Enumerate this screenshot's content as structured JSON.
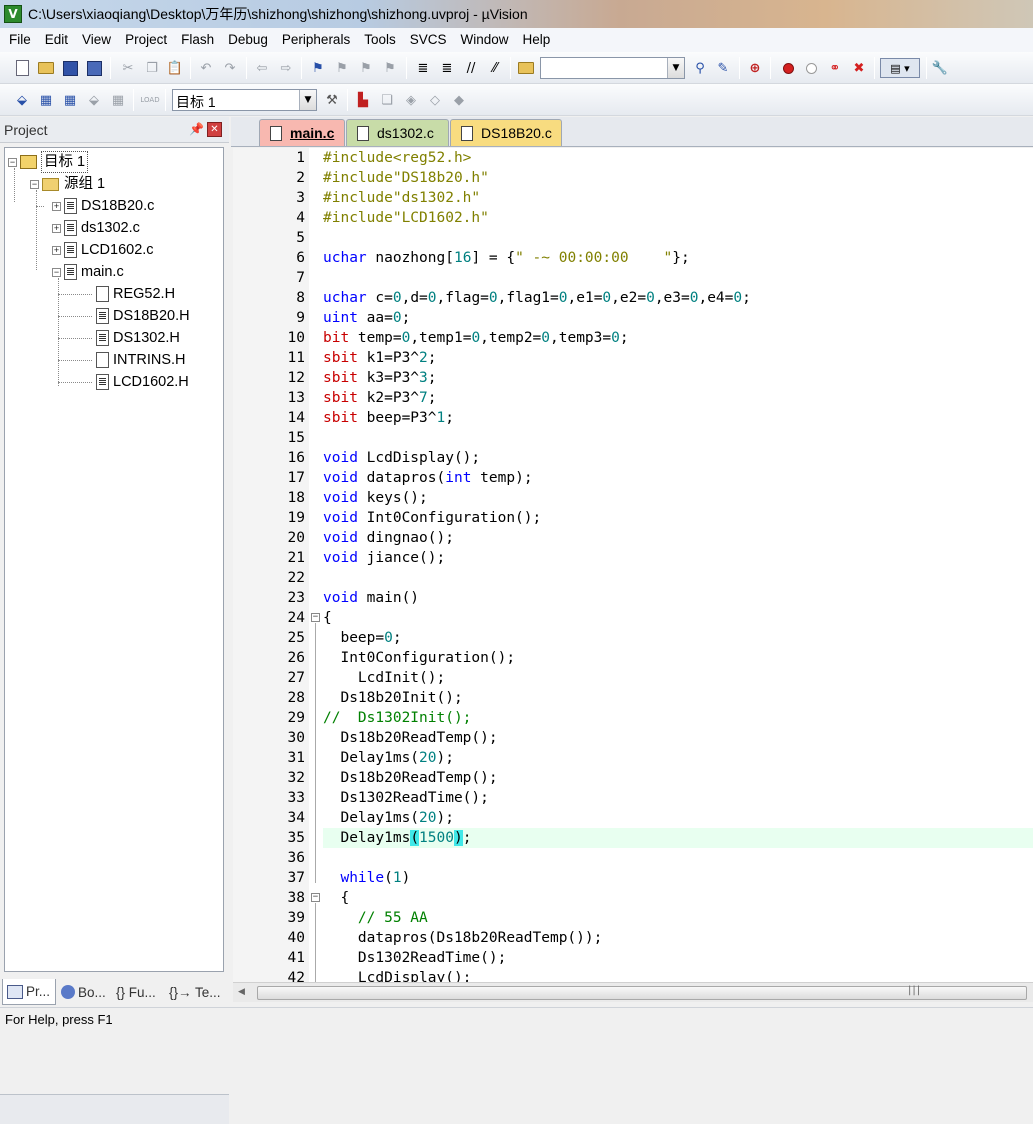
{
  "window": {
    "title": "C:\\Users\\xiaoqiang\\Desktop\\万年历\\shizhong\\shizhong\\shizhong.uvproj - µVision",
    "app_icon_letter": "V"
  },
  "menu": [
    "File",
    "Edit",
    "View",
    "Project",
    "Flash",
    "Debug",
    "Peripherals",
    "Tools",
    "SVCS",
    "Window",
    "Help"
  ],
  "toolbar": {
    "find_combo_value": "",
    "target_combo_value": "目标 1",
    "load_label": "LOAD"
  },
  "project_panel": {
    "title": "Project",
    "tree": {
      "target": "目标 1",
      "group": "源组 1",
      "files": [
        "DS18B20.c",
        "ds1302.c",
        "LCD1602.c",
        "main.c"
      ],
      "main_includes": [
        "REG52.H",
        "DS18B20.H",
        "DS1302.H",
        "INTRINS.H",
        "LCD1602.H"
      ]
    },
    "bottom_tabs": [
      "Pr...",
      "Bo...",
      "{} Fu...",
      "{}→ Te..."
    ]
  },
  "editor": {
    "tabs": [
      "main.c",
      "ds1302.c",
      "DS18B20.c"
    ],
    "active_tab": "main.c",
    "current_line": 35,
    "lines": [
      {
        "n": "1",
        "t": "#include<reg52.h>"
      },
      {
        "n": "2",
        "t": "#include\"DS18b20.h\""
      },
      {
        "n": "3",
        "t": "#include\"ds1302.h\""
      },
      {
        "n": "4",
        "t": "#include\"LCD1602.h\""
      },
      {
        "n": "5",
        "t": ""
      },
      {
        "n": "6",
        "t": "uchar naozhong[16] = {\" -~ 00:00:00    \"};"
      },
      {
        "n": "7",
        "t": ""
      },
      {
        "n": "8",
        "t": "uchar c=0,d=0,flag=0,flag1=0,e1=0,e2=0,e3=0,e4=0;"
      },
      {
        "n": "9",
        "t": "uint aa=0;"
      },
      {
        "n": "10",
        "t": "bit temp=0,temp1=0,temp2=0,temp3=0;"
      },
      {
        "n": "11",
        "t": "sbit k1=P3^2;"
      },
      {
        "n": "12",
        "t": "sbit k3=P3^3;"
      },
      {
        "n": "13",
        "t": "sbit k2=P3^7;"
      },
      {
        "n": "14",
        "t": "sbit beep=P3^1;"
      },
      {
        "n": "15",
        "t": ""
      },
      {
        "n": "16",
        "t": "void LcdDisplay();"
      },
      {
        "n": "17",
        "t": "void datapros(int temp);"
      },
      {
        "n": "18",
        "t": "void keys();"
      },
      {
        "n": "19",
        "t": "void Int0Configuration();"
      },
      {
        "n": "20",
        "t": "void dingnao();"
      },
      {
        "n": "21",
        "t": "void jiance();"
      },
      {
        "n": "22",
        "t": ""
      },
      {
        "n": "23",
        "t": "void main()"
      },
      {
        "n": "24",
        "t": "{"
      },
      {
        "n": "25",
        "t": "  beep=0;"
      },
      {
        "n": "26",
        "t": "  Int0Configuration();"
      },
      {
        "n": "27",
        "t": "    LcdInit();"
      },
      {
        "n": "28",
        "t": "  Ds18b20Init();"
      },
      {
        "n": "29",
        "t": "//  Ds1302Init();"
      },
      {
        "n": "30",
        "t": "  Ds18b20ReadTemp();"
      },
      {
        "n": "31",
        "t": "  Delay1ms(20);"
      },
      {
        "n": "32",
        "t": "  Ds18b20ReadTemp();"
      },
      {
        "n": "33",
        "t": "  Ds1302ReadTime();"
      },
      {
        "n": "34",
        "t": "  Delay1ms(20);"
      },
      {
        "n": "35",
        "t": "  Delay1ms(1500);"
      },
      {
        "n": "36",
        "t": ""
      },
      {
        "n": "37",
        "t": "  while(1)"
      },
      {
        "n": "38",
        "t": "  {"
      },
      {
        "n": "39",
        "t": "    // 55 AA"
      },
      {
        "n": "40",
        "t": "    datapros(Ds18b20ReadTemp());"
      },
      {
        "n": "41",
        "t": "    Ds1302ReadTime();"
      },
      {
        "n": "42",
        "t": "    LcdDisplay();"
      }
    ]
  },
  "status": {
    "text": "For Help, press F1"
  },
  "colors": {
    "keyword": "#0000ff",
    "keyword_sfr": "#c80000",
    "number": "#008080",
    "preprocessor": "#808000",
    "comment": "#008000",
    "brace_match": "#40e8e8",
    "current_line": "#e8fff0"
  }
}
